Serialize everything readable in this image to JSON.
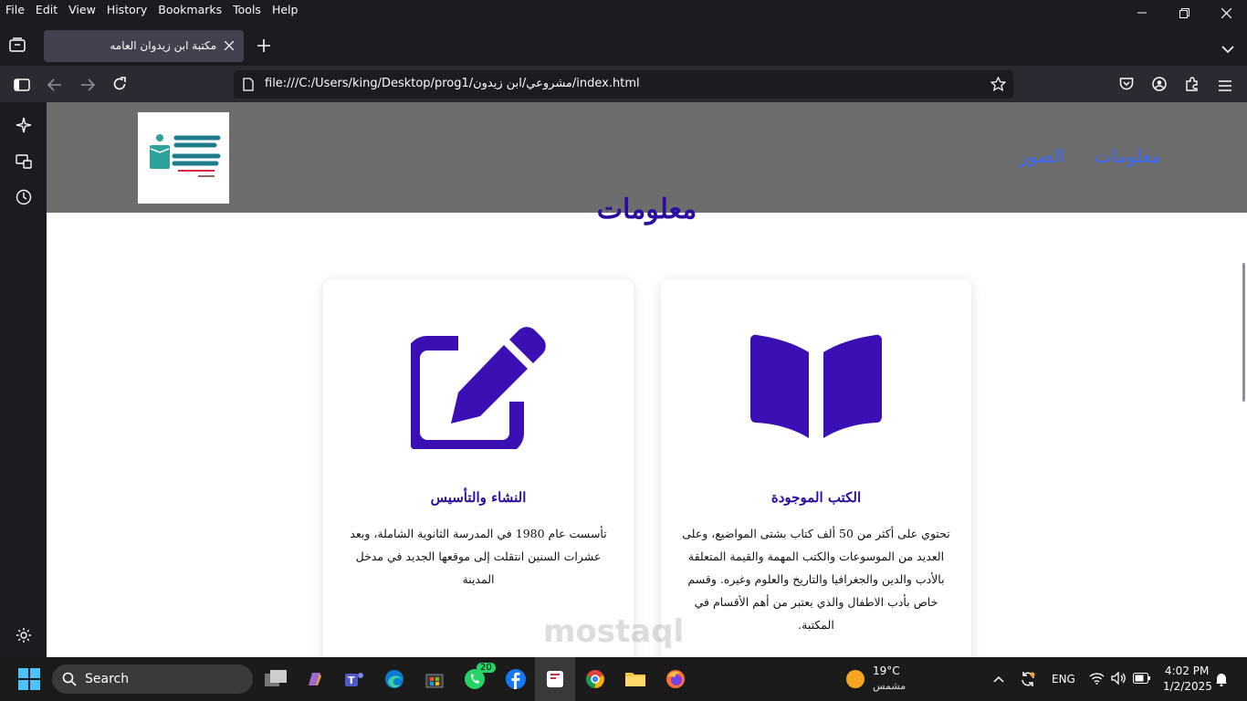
{
  "menu": [
    "File",
    "Edit",
    "View",
    "History",
    "Bookmarks",
    "Tools",
    "Help"
  ],
  "tab": {
    "title": "مكتبة ابن زيدوان العامه"
  },
  "url": "file:///C:/Users/king/Desktop/prog1/مشروعي/ابن زيدون/index.html",
  "site": {
    "logo_alt": "المكتبة العامة",
    "nav": [
      "معلومات",
      "الصور"
    ],
    "heading": "معلومات",
    "cards": [
      {
        "icon": "book-open-icon",
        "title": "الكتب الموجودة",
        "text": "تحتوي على أكثر من 50 ألف كتاب بشتى المواضيع، وعلى العديد من الموسوعات والكتب المهمة والقيمة المتعلقة بالأدب والدين والجغرافيا والتاريخ والعلوم وغيره. وقسم خاص بأدب الاطفال والذي يعتبر من أهم الأقسام في المكتبة."
      },
      {
        "icon": "edit-icon",
        "title": "النشاء والتأسيس",
        "text": "تأسست عام 1980 في المدرسة الثانوية الشاملة، وبعد عشرات السنين انتقلت إلى موقعها الجديد في مدخل المدينة"
      }
    ]
  },
  "taskbar": {
    "search_label": "Search",
    "whatsapp_badge": "20",
    "weather_temp": "19°C",
    "weather_desc": "مشمس",
    "lang": "ENG",
    "time": "4:02 PM",
    "date": "1/2/2025"
  },
  "colors": {
    "accent": "#2b0e9e",
    "nav_link": "#3d6bff",
    "header_bg": "#6d6d6d"
  }
}
